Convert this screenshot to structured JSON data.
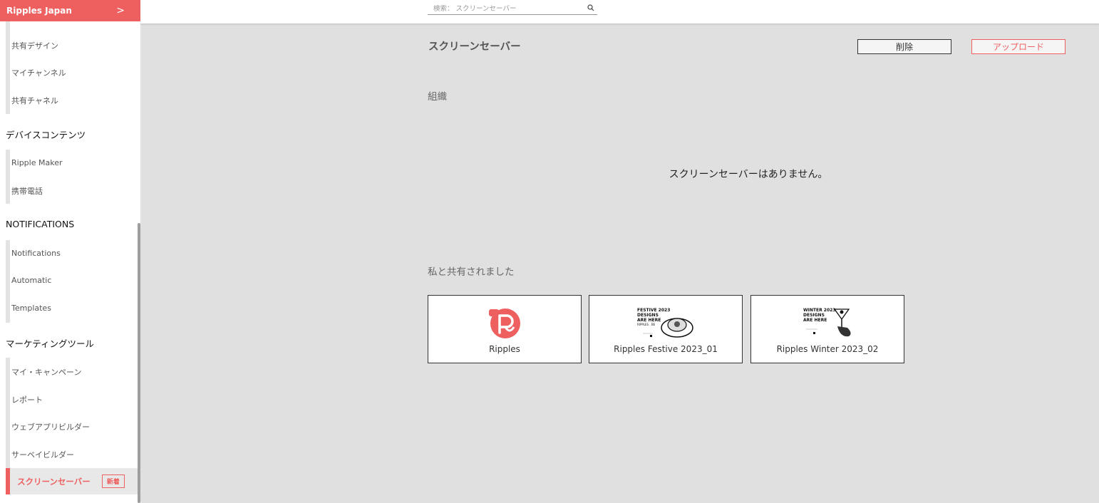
{
  "sidebar": {
    "org_name": "Ripples Japan",
    "org_chevron": ">",
    "top_items": [
      "共有デザイン",
      "マイチャンネル",
      "共有チャネル"
    ],
    "device_section": "デバイスコンテンツ",
    "device_items": [
      "Ripple Maker",
      "携帯電話"
    ],
    "notifications_section": "NOTIFICATIONS",
    "notifications_items": [
      "Notifications",
      "Automatic",
      "Templates"
    ],
    "marketing_section": "マーケティングツール",
    "marketing_items": [
      "マイ・キャンペーン",
      "レポート",
      "ウェブアプリビルダー",
      "サーベイビルダー"
    ],
    "active_item": "スクリーンセーバー",
    "active_badge": "新着",
    "accent_color": "#ee5f5f"
  },
  "search": {
    "placeholder": "検索： スクリーンセーバー",
    "icon": "search-icon"
  },
  "main": {
    "title": "スクリーンセーバー",
    "delete_label": "削除",
    "upload_label": "アップロード",
    "org_heading": "組織",
    "empty_message": "スクリーンセーバーはありません。",
    "shared_heading": "私と共有されました",
    "cards": [
      {
        "name": "Ripples",
        "thumb": "ripples-logo"
      },
      {
        "name": "Ripples Festive 2023_01",
        "thumb": "festive-design",
        "lines": [
          "FESTIVE 2023",
          "DESIGNS",
          "ARE HERE",
          "RIPPLES . BE"
        ]
      },
      {
        "name": "Ripples Winter 2023_02",
        "thumb": "winter-design",
        "lines": [
          "WINTER 2023",
          "DESIGNS",
          "ARE HERE"
        ]
      }
    ]
  }
}
